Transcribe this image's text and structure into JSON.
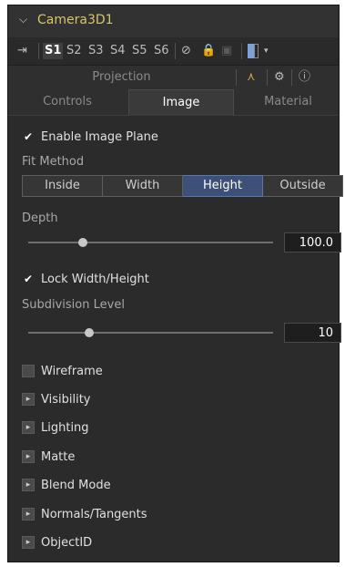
{
  "header": {
    "title": "Camera3D1"
  },
  "toolbar": {
    "slots": [
      "S1",
      "S2",
      "S3",
      "S4",
      "S5",
      "S6"
    ],
    "active_slot": "S1"
  },
  "tabs_row1": {
    "projection": "Projection"
  },
  "tabs_row2": {
    "controls": "Controls",
    "image": "Image",
    "material": "Material"
  },
  "image_panel": {
    "enable_image_plane": {
      "label": "Enable Image Plane",
      "checked": true
    },
    "fit_method": {
      "label": "Fit Method",
      "options": [
        "Inside",
        "Width",
        "Height",
        "Outside"
      ],
      "selected": "Height"
    },
    "depth": {
      "label": "Depth",
      "value": "100.0"
    },
    "lock_wh": {
      "label": "Lock Width/Height",
      "checked": true
    },
    "subdivision": {
      "label": "Subdivision Level",
      "value": "10"
    },
    "wireframe": {
      "label": "Wireframe",
      "checked": false
    },
    "sections": [
      "Visibility",
      "Lighting",
      "Matte",
      "Blend Mode",
      "Normals/Tangents",
      "ObjectID"
    ]
  },
  "colors": {
    "title": "#d8c46a",
    "accent": "#3c5078"
  }
}
